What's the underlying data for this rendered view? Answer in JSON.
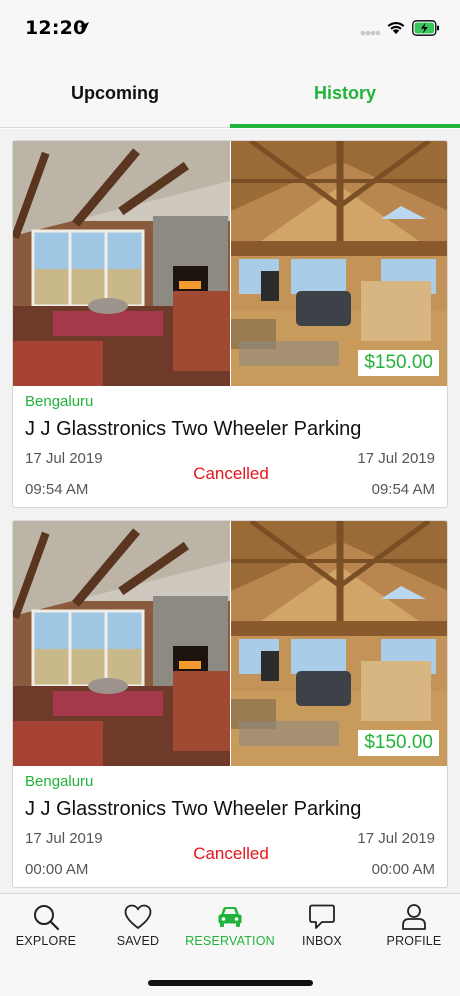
{
  "status_bar": {
    "time": "12:20"
  },
  "tabs": [
    {
      "label": "Upcoming"
    },
    {
      "label": "History"
    }
  ],
  "reservations": [
    {
      "city": "Bengaluru",
      "name": "J J Glasstronics Two Wheeler Parking",
      "price": "$150.00",
      "start_date": "17 Jul 2019",
      "end_date": "17 Jul 2019",
      "start_time": "09:54 AM",
      "end_time": "09:54 AM",
      "status": "Cancelled"
    },
    {
      "city": "Bengaluru",
      "name": "J J Glasstronics Two Wheeler Parking",
      "price": "$150.00",
      "start_date": "17 Jul 2019",
      "end_date": "17 Jul 2019",
      "start_time": "00:00 AM",
      "end_time": "00:00 AM",
      "status": "Cancelled"
    }
  ],
  "bottom_nav": [
    {
      "label": "EXPLORE",
      "icon": "search-icon"
    },
    {
      "label": "SAVED",
      "icon": "heart-icon"
    },
    {
      "label": "RESERVATION",
      "icon": "car-icon"
    },
    {
      "label": "INBOX",
      "icon": "chat-bubble-icon"
    },
    {
      "label": "PROFILE",
      "icon": "person-icon"
    }
  ],
  "colors": {
    "accent": "#22b33a",
    "cancelled": "#e4161c"
  }
}
